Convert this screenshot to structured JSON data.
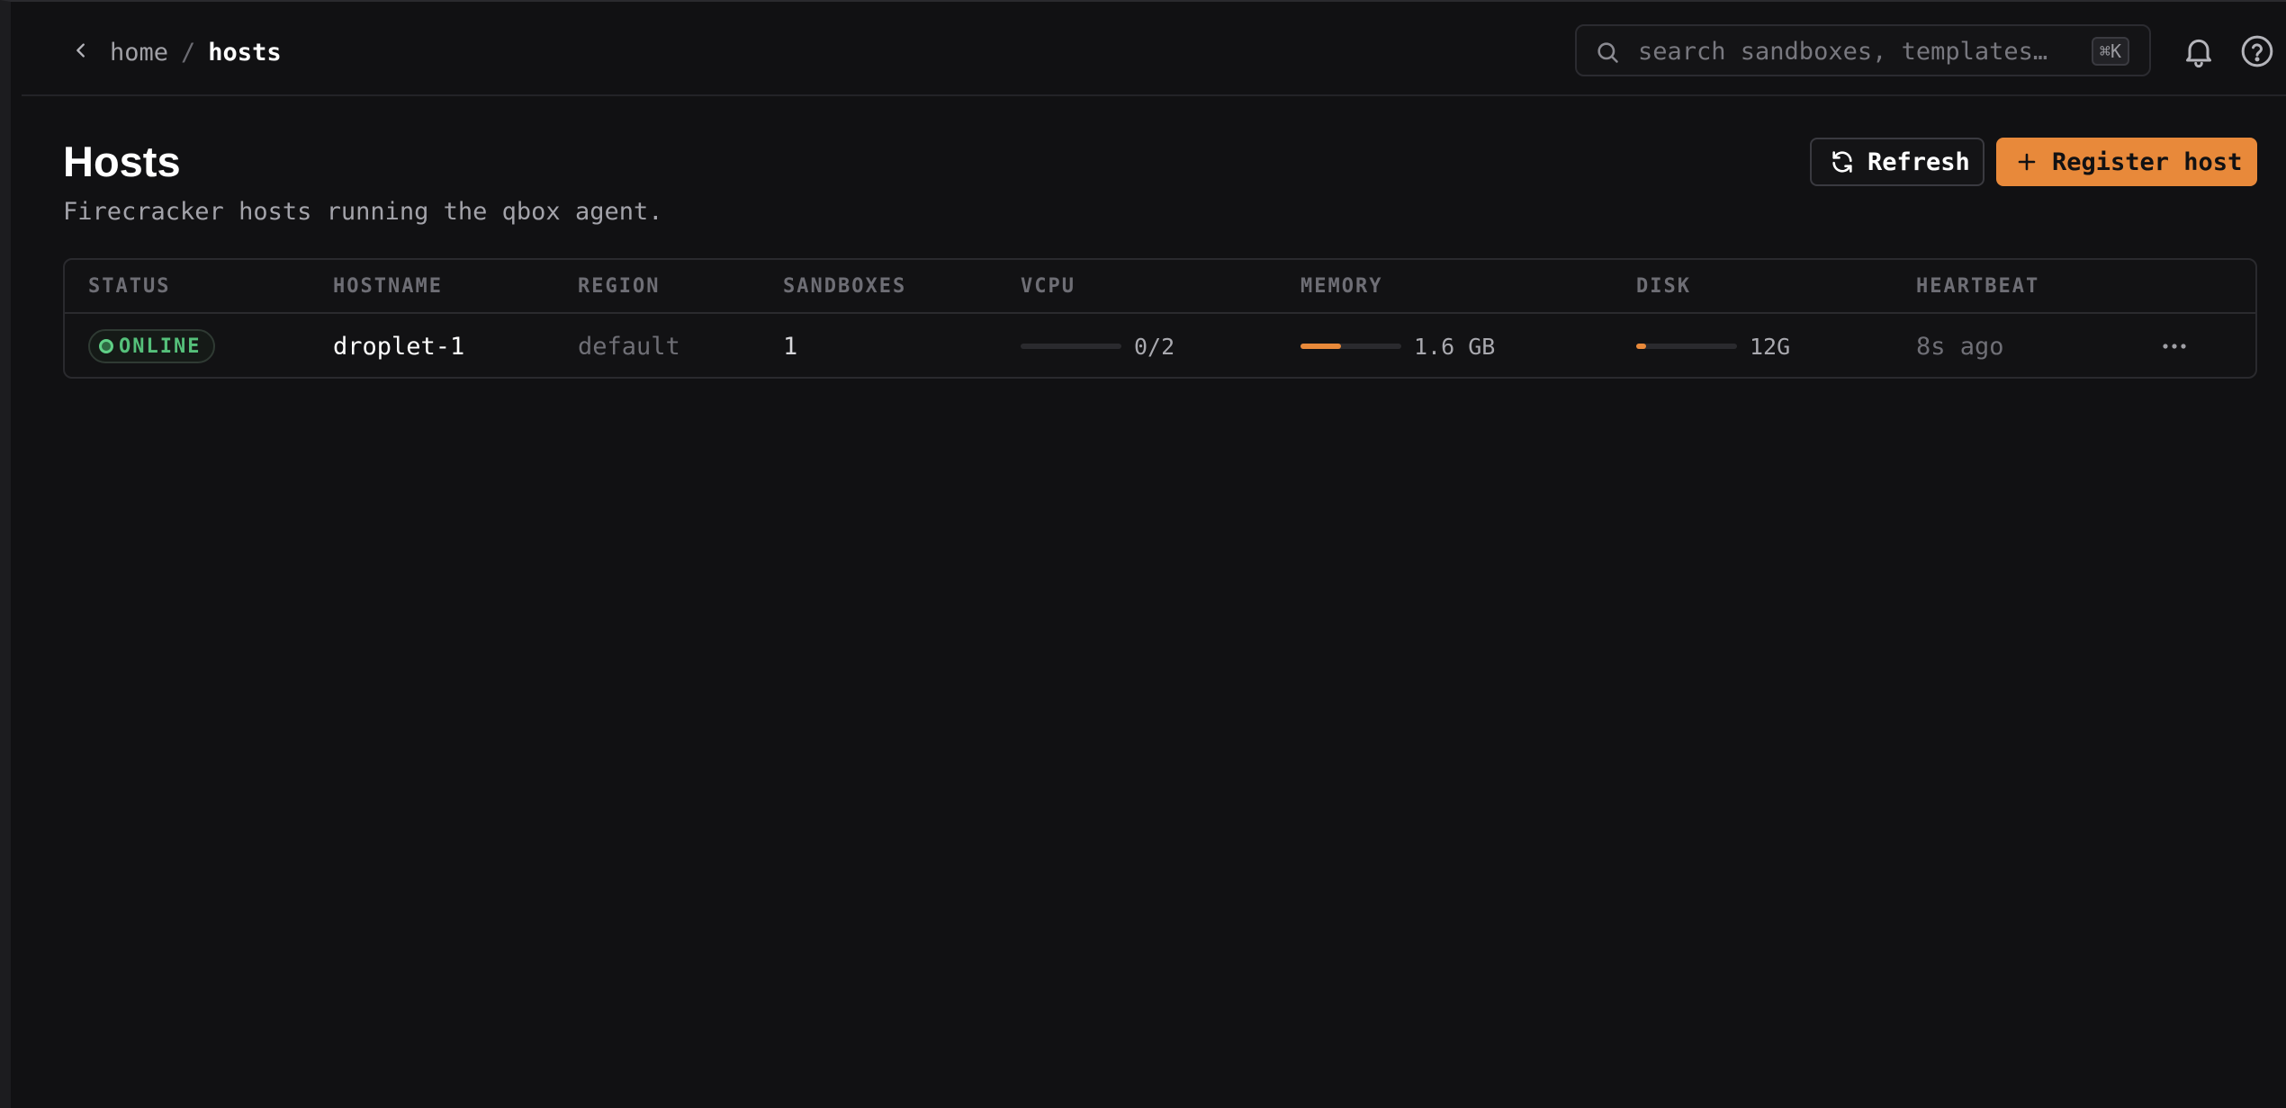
{
  "breadcrumb": {
    "home": "home",
    "separator": "/",
    "current": "hosts"
  },
  "search": {
    "placeholder": "search sandboxes, templates…",
    "shortcut": "⌘K"
  },
  "header": {
    "title": "Hosts",
    "subtitle": "Firecracker hosts running the qbox agent.",
    "refresh_label": "Refresh",
    "register_label": "Register host"
  },
  "table": {
    "columns": [
      "STATUS",
      "HOSTNAME",
      "REGION",
      "SANDBOXES",
      "VCPU",
      "MEMORY",
      "DISK",
      "HEARTBEAT"
    ],
    "rows": [
      {
        "status": "ONLINE",
        "hostname": "droplet-1",
        "region": "default",
        "sandboxes": "1",
        "vcpu": "0/2",
        "vcpu_fraction": 0.0,
        "memory": "1.6 GB",
        "memory_fraction": 0.4,
        "disk": "12G",
        "disk_fraction": 0.1,
        "heartbeat": "8s ago"
      }
    ]
  },
  "colors": {
    "accent": "#e8893a",
    "online": "#55c07a",
    "background": "#111113"
  },
  "icons": [
    "chevron-left-icon",
    "search-icon",
    "bell-icon",
    "help-icon",
    "refresh-icon",
    "plus-icon",
    "more-icon"
  ]
}
